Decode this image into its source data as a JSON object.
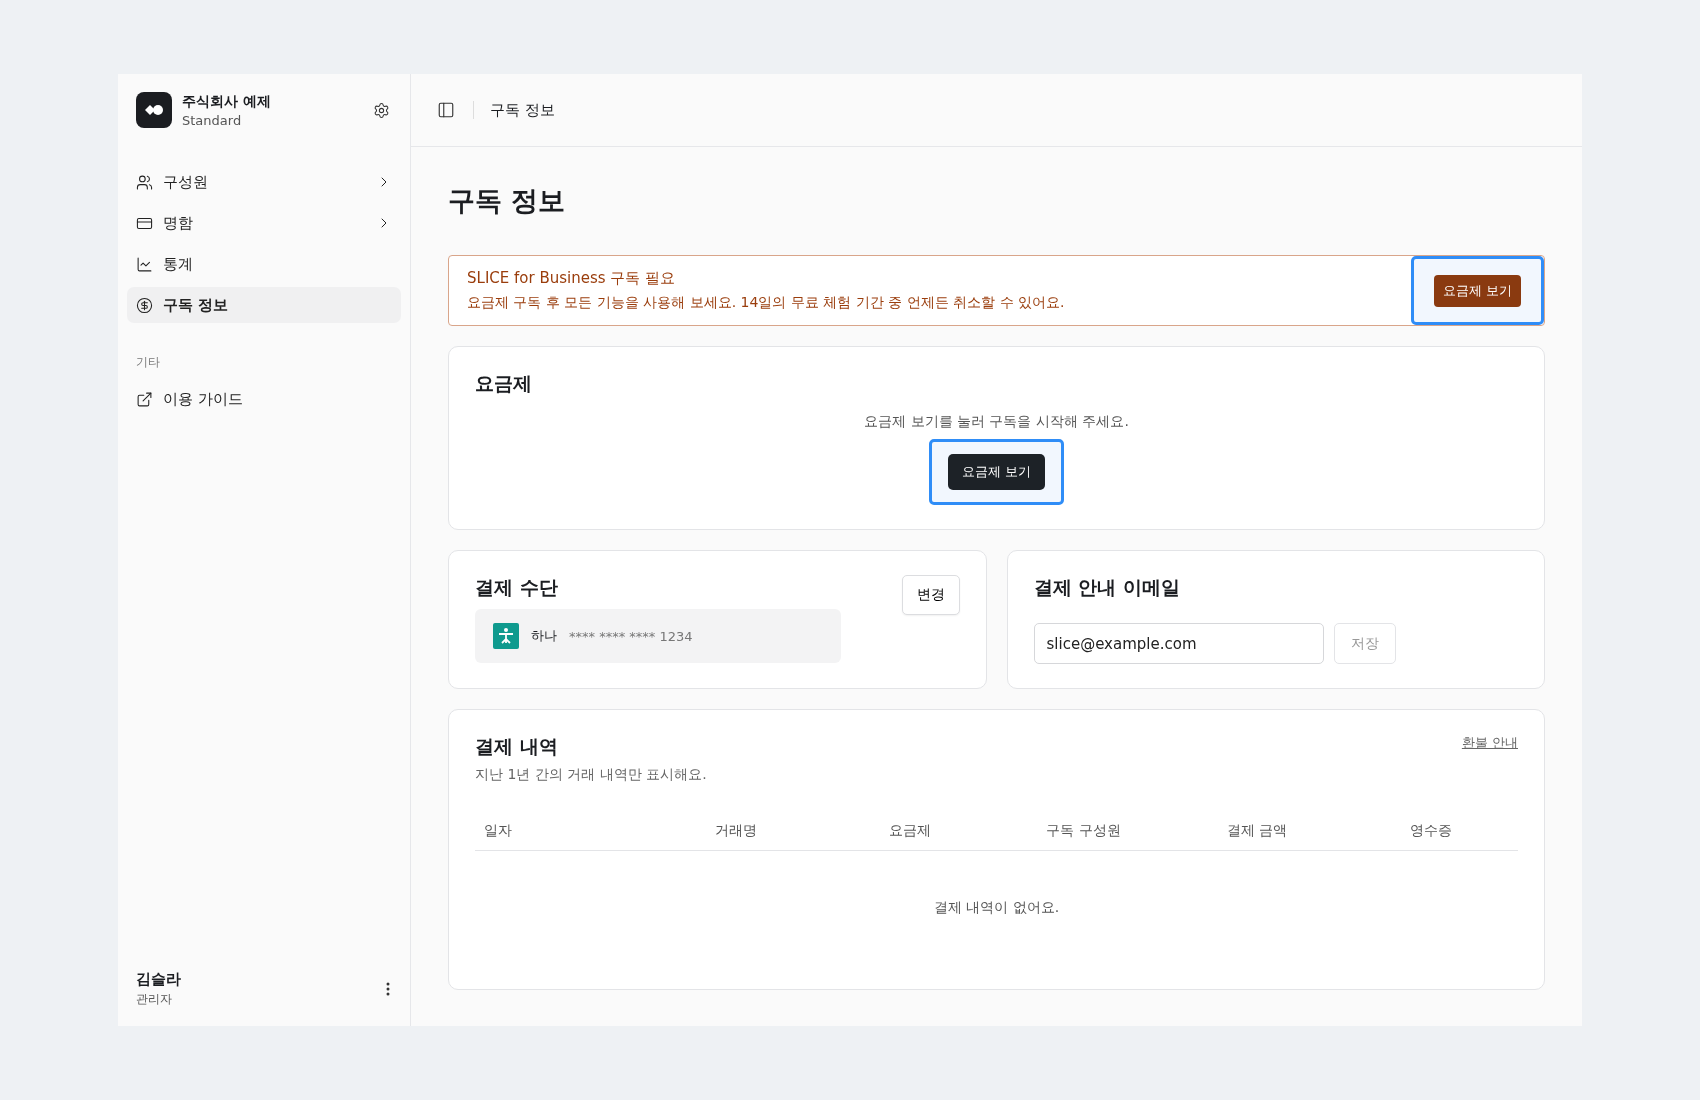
{
  "workspace": {
    "name": "주식회사 예제",
    "plan": "Standard"
  },
  "sidebar": {
    "items": [
      {
        "label": "구성원",
        "has_children": true,
        "selected": false
      },
      {
        "label": "명함",
        "has_children": true,
        "selected": false
      },
      {
        "label": "통계",
        "has_children": false,
        "selected": false
      },
      {
        "label": "구독 정보",
        "has_children": false,
        "selected": true
      }
    ],
    "section_title": "기타",
    "extra_items": [
      {
        "label": "이용 가이드",
        "has_children": false,
        "selected": false
      }
    ]
  },
  "user": {
    "name": "김슬라",
    "role": "관리자"
  },
  "header": {
    "breadcrumb": "구독 정보"
  },
  "page_title": "구독 정보",
  "alert": {
    "title": "SLICE for Business 구독 필요",
    "message": "요금제 구독 후 모든 기능을 사용해 보세요. 14일의 무료 체험 기간 중 언제든 취소할 수 있어요.",
    "button": {
      "label": "요금제 보기",
      "focused": true
    }
  },
  "plan_card": {
    "title": "요금제",
    "message": "요금제 보기를 눌러 구독을 시작해 주세요.",
    "button": {
      "label": "요금제 보기",
      "focused": true
    }
  },
  "payment_method": {
    "title": "결제 수단",
    "change_button": "변경",
    "bank": "하나",
    "card_number": "**** **** **** 1234"
  },
  "billing_email": {
    "title": "결제 안내 이메일",
    "value": "slice@example.com",
    "save_button": {
      "label": "저장",
      "disabled": true
    }
  },
  "history": {
    "title": "결제 내역",
    "subtitle": "지난 1년 간의 거래 내역만 표시해요.",
    "refund_link": "환불 안내",
    "columns": [
      "일자",
      "거래명",
      "요금제",
      "구독 구성원",
      "결제 금액",
      "영수증"
    ],
    "empty_message": "결제 내역이 없어요."
  }
}
